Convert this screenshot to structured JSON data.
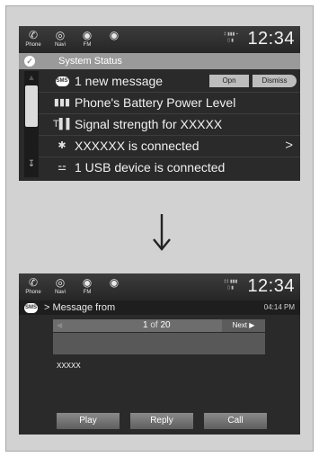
{
  "top_nav": {
    "phone_label": "Phone",
    "navi_label": "Navi",
    "fm_label": "FM"
  },
  "screen1": {
    "clock": "12:34",
    "system_status": "System Status",
    "rows": [
      {
        "icon": "sms-icon",
        "text": "1 new message",
        "open": "Opn",
        "dismiss": "Dismiss"
      },
      {
        "icon": "battery-icon",
        "text": "Phone's Battery Power Level"
      },
      {
        "icon": "signal-icon",
        "text": "Signal strength for XXXXX"
      },
      {
        "icon": "bluetooth-icon",
        "text": "XXXXXX  is connected"
      },
      {
        "icon": "usb-icon",
        "text": "1 USB device is connected"
      }
    ]
  },
  "screen2": {
    "clock": "12:34",
    "title": "> Message from",
    "time": "04:14 PM",
    "pager_current": "1",
    "pager_of": "of",
    "pager_total": "20",
    "next_label": "Next",
    "sender": "XXXXX",
    "actions": {
      "play": "Play",
      "reply": "Reply",
      "call": "Call"
    }
  },
  "colors": {
    "screen_bg": "#2a2a2a",
    "highlight": "#9a9a9a",
    "frame": "#d2d2d2"
  }
}
